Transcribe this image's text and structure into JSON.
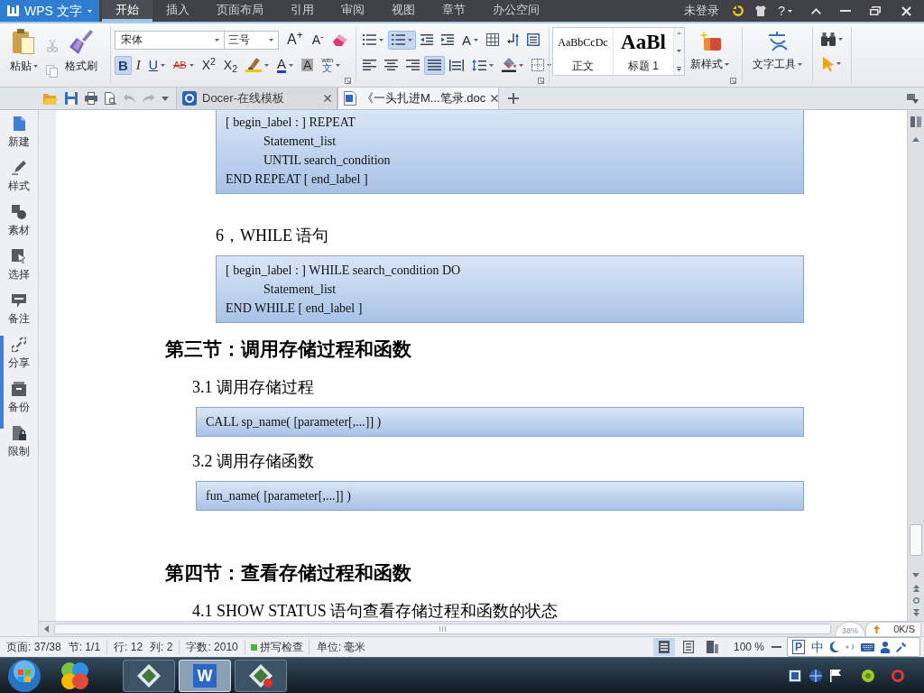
{
  "title_bar": {
    "app_button": "WPS 文字",
    "menu_tabs": [
      {
        "label": "开始",
        "selected": true
      },
      {
        "label": "插入",
        "selected": false
      },
      {
        "label": "页面布局",
        "selected": false
      },
      {
        "label": "引用",
        "selected": false
      },
      {
        "label": "审阅",
        "selected": false
      },
      {
        "label": "视图",
        "selected": false
      },
      {
        "label": "章节",
        "selected": false
      },
      {
        "label": "办公空间",
        "selected": false
      }
    ],
    "login": "未登录",
    "help": "?"
  },
  "ribbon": {
    "clipboard": {
      "paste": "粘贴",
      "format_painter": "格式刷",
      "small_buttons": [
        {
          "kind": "cut",
          "disabled": true
        },
        {
          "kind": "copy",
          "disabled": true
        }
      ]
    },
    "font": {
      "font_name": "宋体",
      "font_size": "三号",
      "row_1": [
        {
          "kind": "grow_font",
          "label": "A$^{+}$"
        },
        {
          "kind": "shrink_font",
          "label": "A$^{-}$"
        },
        {
          "kind": "clear_format"
        }
      ],
      "row_2": [
        {
          "kind": "bold",
          "label": "B",
          "selected": true,
          "dropdown": false
        },
        {
          "kind": "italic",
          "label": "I",
          "selected": false,
          "dropdown": false
        },
        {
          "kind": "underline",
          "label": "U",
          "selected": false,
          "dropdown": true
        },
        {
          "kind": "strikethrough",
          "label": "AB",
          "selected": false,
          "dropdown": true
        },
        {
          "kind": "superscript",
          "label": "X$^{2}$",
          "selected": false,
          "dropdown": false
        },
        {
          "kind": "subscript",
          "label": "X$_{2}$",
          "selected": false,
          "dropdown": false
        },
        {
          "kind": "highlight",
          "selected": false,
          "dropdown": true
        },
        {
          "kind": "font_color",
          "label": "A",
          "selected": false,
          "dropdown": true
        },
        {
          "kind": "char_shading",
          "label": "A",
          "selected": false,
          "dropdown": false
        },
        {
          "kind": "pinyin",
          "ruby": "wén",
          "label": "文",
          "selected": false,
          "dropdown": true
        }
      ]
    },
    "paragraph": {
      "row_1": [
        {
          "kind": "bullets",
          "selected": false,
          "dropdown": true
        },
        {
          "kind": "numbering",
          "selected": true,
          "dropdown": true
        },
        {
          "kind": "decrease_indent",
          "selected": false,
          "dropdown": false
        },
        {
          "kind": "increase_indent",
          "selected": false,
          "dropdown": false
        },
        {
          "kind": "char_scale",
          "label": "A",
          "selected": false,
          "dropdown": true
        },
        {
          "kind": "table",
          "selected": false,
          "dropdown": false
        },
        {
          "kind": "show_marks",
          "selected": false,
          "dropdown": false
        },
        {
          "kind": "page_frame",
          "selected": false,
          "dropdown": false
        }
      ],
      "row_2": [
        {
          "kind": "align_left",
          "selected": false,
          "dropdown": false
        },
        {
          "kind": "align_center",
          "selected": false,
          "dropdown": false
        },
        {
          "kind": "align_right",
          "selected": false,
          "dropdown": false
        },
        {
          "kind": "justify",
          "selected": true,
          "dropdown": false
        },
        {
          "kind": "distribute",
          "selected": false,
          "dropdown": false
        },
        {
          "kind": "line_spacing",
          "selected": false,
          "dropdown": true
        },
        {
          "kind": "shading",
          "selected": false,
          "dropdown": true
        },
        {
          "kind": "borders",
          "selected": false,
          "dropdown": true
        }
      ]
    },
    "styles": {
      "gallery": [
        {
          "kind": "body",
          "preview": "AaBbCcDc",
          "label": "正文"
        },
        {
          "kind": "heading",
          "preview": "AaBl",
          "label": "标题 1"
        }
      ],
      "new_style": "新样式"
    },
    "text_tools": "文字工具",
    "editing": [
      {
        "kind": "find",
        "dropdown": true
      },
      {
        "kind": "select",
        "dropdown": true
      }
    ]
  },
  "quick_access": [
    {
      "kind": "open",
      "disabled": false
    },
    {
      "kind": "save",
      "disabled": false
    },
    {
      "kind": "print",
      "disabled": false
    },
    {
      "kind": "print_preview",
      "disabled": false
    },
    {
      "kind": "undo",
      "disabled": true
    },
    {
      "kind": "redo",
      "disabled": true
    },
    {
      "kind": "customize",
      "disabled": false
    }
  ],
  "doc_tabs": [
    {
      "kind": "docer",
      "label": "Docer-在线模板",
      "selected": false
    },
    {
      "kind": "document",
      "label": "《一头扎进M...笔录.doc",
      "selected": true
    }
  ],
  "sidebar": [
    {
      "kind": "new",
      "label": "新建"
    },
    {
      "kind": "style",
      "label": "样式"
    },
    {
      "kind": "material",
      "label": "素材"
    },
    {
      "kind": "select",
      "label": "选择"
    },
    {
      "kind": "note",
      "label": "备注"
    },
    {
      "kind": "share",
      "label": "分享"
    },
    {
      "kind": "backup",
      "label": "备份"
    },
    {
      "kind": "restrict",
      "label": "限制"
    }
  ],
  "document": {
    "blocks": [
      {
        "kind": "code",
        "lines": [
          {
            "text": "[ begin_label : ] REPEAT",
            "children": [
              {
                "text": "Statement_list"
              },
              {
                "text": "UNTIL search_condition"
              }
            ]
          },
          {
            "text": "END REPEAT [ end_label ]"
          }
        ]
      },
      {
        "kind": "item_heading",
        "text": "6，WHILE 语句"
      },
      {
        "kind": "code",
        "lines": [
          {
            "text": "[ begin_label : ] WHILE search_condition DO",
            "children": [
              {
                "text": "Statement_list"
              }
            ]
          },
          {
            "text": "END WHILE [ end_label ]"
          }
        ]
      },
      {
        "kind": "section_heading",
        "text": "第三节：调用存储过程和函数"
      },
      {
        "kind": "subsection",
        "text": "3.1 调用存储过程"
      },
      {
        "kind": "code",
        "lines": [
          {
            "text": "CALL sp_name( [parameter[,...]] )"
          }
        ]
      },
      {
        "kind": "subsection",
        "text": "3.2 调用存储函数"
      },
      {
        "kind": "code",
        "lines": [
          {
            "text": "fun_name( [parameter[,...]] )"
          }
        ]
      },
      {
        "kind": "section_heading",
        "text": "第四节：查看存储过程和函数"
      },
      {
        "kind": "subsection",
        "text": "4.1 SHOW STATUS 语句查看存储过程和函数的状态"
      }
    ]
  },
  "status_bar": {
    "groups": [
      [
        "页面: 37/38",
        "节: 1/1"
      ],
      [
        "行: 12",
        "列: 2"
      ],
      [
        "字数: 2010"
      ]
    ],
    "spell_check": {
      "label": "拼写检查",
      "on": true
    },
    "unit": "单位: 毫米",
    "views": [
      {
        "kind": "page",
        "selected": true
      },
      {
        "kind": "outline",
        "selected": false
      },
      {
        "kind": "web",
        "selected": false
      }
    ],
    "zoom": "100 %",
    "ime": {
      "logo": "P",
      "mode": "中"
    }
  },
  "network_widget": {
    "usage": "38%",
    "speed": "0K/S"
  },
  "taskbar": {
    "buttons": [
      {
        "kind": "app",
        "selected": false
      },
      {
        "kind": "writer",
        "label": "W",
        "selected": true
      },
      {
        "kind": "app_alert",
        "selected": false
      }
    ]
  }
}
